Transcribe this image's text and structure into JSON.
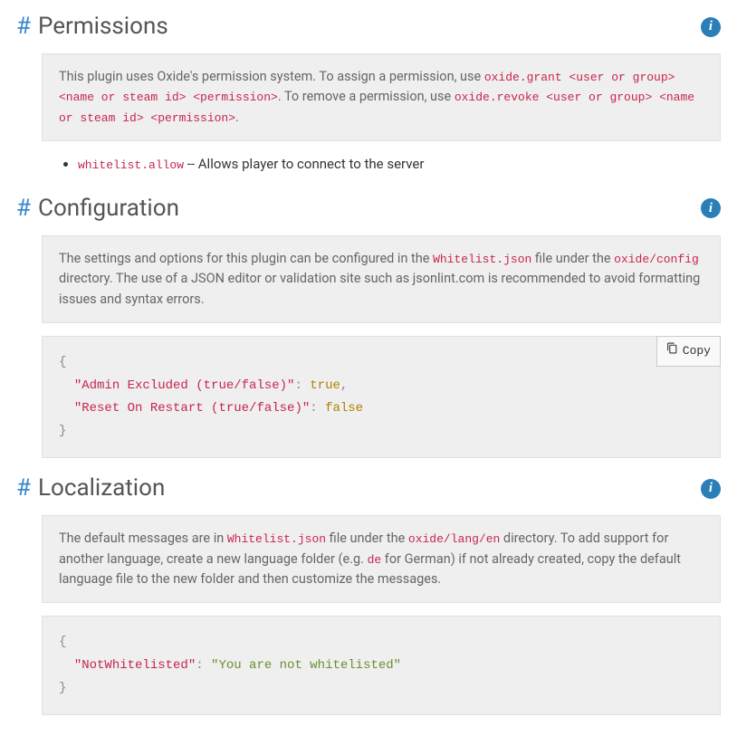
{
  "sections": {
    "permissions": {
      "title": "Permissions",
      "info_pre": "This plugin uses Oxide's permission system. To assign a permission, use ",
      "grant_cmd": "oxide.grant <user or group> <name or steam id> <permission>",
      "info_mid": ". To remove a permission, use ",
      "revoke_cmd": "oxide.revoke <user or group> <name or steam id> <permission>",
      "info_end": ".",
      "perm_code": "whitelist.allow",
      "perm_desc": " -- Allows player to connect to the server"
    },
    "configuration": {
      "title": "Configuration",
      "info_pre": "The settings and options for this plugin can be configured in the ",
      "file": "Whitelist.json",
      "info_mid": " file under the ",
      "dir": "oxide/config",
      "info_end": " directory. The use of a JSON editor or validation site such as jsonlint.com is recommended to avoid formatting issues and syntax errors.",
      "copy_label": "Copy",
      "key1": "\"Admin Excluded (true/false)\"",
      "val1": "true",
      "key2": "\"Reset On Restart (true/false)\"",
      "val2": "false"
    },
    "localization": {
      "title": "Localization",
      "info_pre": "The default messages are in ",
      "file": "Whitelist.json",
      "info_mid": " file under the ",
      "dir": "oxide/lang/en",
      "info_after_dir": " directory. To add support for another language, create a new language folder (e.g. ",
      "lang_code": "de",
      "info_end": " for German) if not already created, copy the default language file to the new folder and then customize the messages.",
      "key1": "\"NotWhitelisted\"",
      "val1": "\"You are not whitelisted\""
    }
  }
}
